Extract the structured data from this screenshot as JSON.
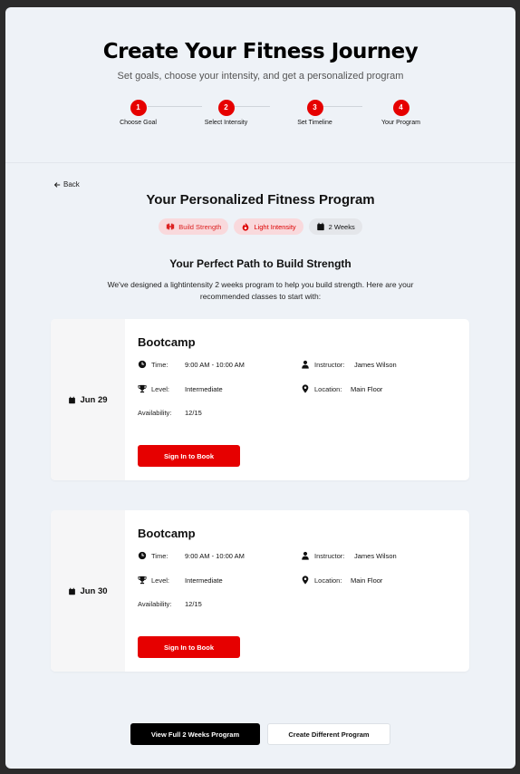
{
  "header": {
    "title": "Create Your Fitness Journey",
    "subtitle": "Set goals, choose your intensity, and get a personalized program"
  },
  "steps": [
    {
      "number": "1",
      "label": "Choose Goal"
    },
    {
      "number": "2",
      "label": "Select Intensity"
    },
    {
      "number": "3",
      "label": "Set Timeline"
    },
    {
      "number": "4",
      "label": "Your Program"
    }
  ],
  "nav": {
    "back_label": "Back"
  },
  "program": {
    "title": "Your Personalized Fitness Program",
    "tags": [
      {
        "label": "Build Strength",
        "icon": "dumbbell-icon"
      },
      {
        "label": "Light Intensity",
        "icon": "flame-icon"
      },
      {
        "label": "2 Weeks",
        "icon": "calendar-icon"
      }
    ],
    "path_title": "Your Perfect Path to Build Strength",
    "description": "We've designed a lightintensity 2 weeks program to help you build strength. Here are your recommended classes to start with:"
  },
  "classes": [
    {
      "date": "Jun 29",
      "name": "Bootcamp",
      "time_label": "Time:",
      "time": "9:00 AM - 10:00 AM",
      "instructor_label": "Instructor:",
      "instructor": "James Wilson",
      "level_label": "Level:",
      "level": "Intermediate",
      "location_label": "Location:",
      "location": "Main Floor",
      "availability_label": "Availability:",
      "availability": "12/15",
      "button": "Sign In to Book"
    },
    {
      "date": "Jun 30",
      "name": "Bootcamp",
      "time_label": "Time:",
      "time": "9:00 AM - 10:00 AM",
      "instructor_label": "Instructor:",
      "instructor": "James Wilson",
      "level_label": "Level:",
      "level": "Intermediate",
      "location_label": "Location:",
      "location": "Main Floor",
      "availability_label": "Availability:",
      "availability": "12/15",
      "button": "Sign In to Book"
    }
  ],
  "actions": {
    "view_full": "View Full 2 Weeks Program",
    "create_different": "Create Different Program"
  },
  "colors": {
    "accent": "#e60000",
    "background": "#eef2f7",
    "tag_background": "#f9d9dc"
  }
}
